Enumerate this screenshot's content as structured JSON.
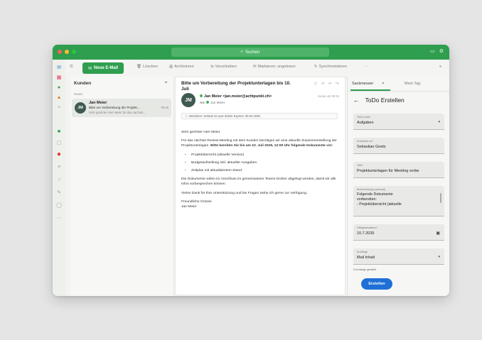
{
  "colors": {
    "accent": "#2f9e4f",
    "primary_button": "#1f6fd6",
    "avatar": "#3f5a51"
  },
  "titlebar": {
    "search_label": "Suchen"
  },
  "toolbar": {
    "new_mail": "Neue E-Mail",
    "delete": "Löschen",
    "archive": "Archivieren",
    "move": "Verschieben",
    "mark_read": "Markieren: ungelesen",
    "sync": "Synchronisieren",
    "more": "···"
  },
  "list": {
    "header": "Kunden",
    "group": "Heute",
    "items": [
      {
        "initials": "JM",
        "from": "Jan Meier",
        "subject": "Bitte um Vorbereitung der Projekt...",
        "time": "09:16",
        "preview": "Sehr geehrter Herr Meier für das nächste..."
      }
    ]
  },
  "reading": {
    "subject": "Bitte um Vorbereitung der Projektunterlagen bis 10. Juli",
    "sender_initials": "JM",
    "sender": "Jan Meier <jan.meier@achtpunkt.ch>",
    "to_label": "An:",
    "to": "Jan Meier",
    "date": "Heute um 09:16",
    "notice": "Betreiben: Default 10 year delete Expires: 08.04.2035",
    "greeting": "Sehr geehrter Herr Meier",
    "para1_a": "Für das nächste Review-Meeting mit dem Kunden benötigen wir eine aktuelle Zusammenstellung der Projektunterlagen. ",
    "para1_b": "Bitte bereiten Sie bis am 10. Juli 2026, 12:00 Uhr folgende Dokumente vor:",
    "bullets": [
      "Projektübersicht (aktuelle Version)",
      "Budgetaufstellung inkl. aktueller Ausgaben",
      "Zeitplan mit aktualisiertem Stand"
    ],
    "para2": "Die Dokumente sollen im Anschluss im gemeinsamen Teams-Ordner abgelegt werden, damit wir alle Infos vorbesprechen können.",
    "para3": "Vielen Dank für Ihre Unterstützung und bei Fragen stehe ich gerne zur Verfügung.",
    "closing": "Freundliche Grüsse",
    "signature": "Jan Meier"
  },
  "panel": {
    "tab_active": "Sackmesser",
    "tab_close": "×",
    "tab_other": "Mein Tag",
    "title": "ToDo Erstellen",
    "back": "←",
    "fields": {
      "list_label": "ToDo-Liste*",
      "list_value": "Aufgaben",
      "assignee_label": "Zuweisen an*",
      "assignee_value": "Sebastian Goetz",
      "title_label": "Titel*",
      "title_value": "Projektunterlagen für Meeting vorbe",
      "desc_label": "Beschreibung (optional)",
      "desc_value": "Folgende Dokumente\nvorbereiten:\n- Projektübersicht (aktuelle",
      "due_label": "Fälligkeitsdatum*",
      "due_value": "10.7.2026",
      "attach_label": "Anhänge",
      "attach_value": "Mail Inhalt"
    },
    "attach_hint": "0 Anhänge gewählt",
    "create": "Erstellen"
  }
}
